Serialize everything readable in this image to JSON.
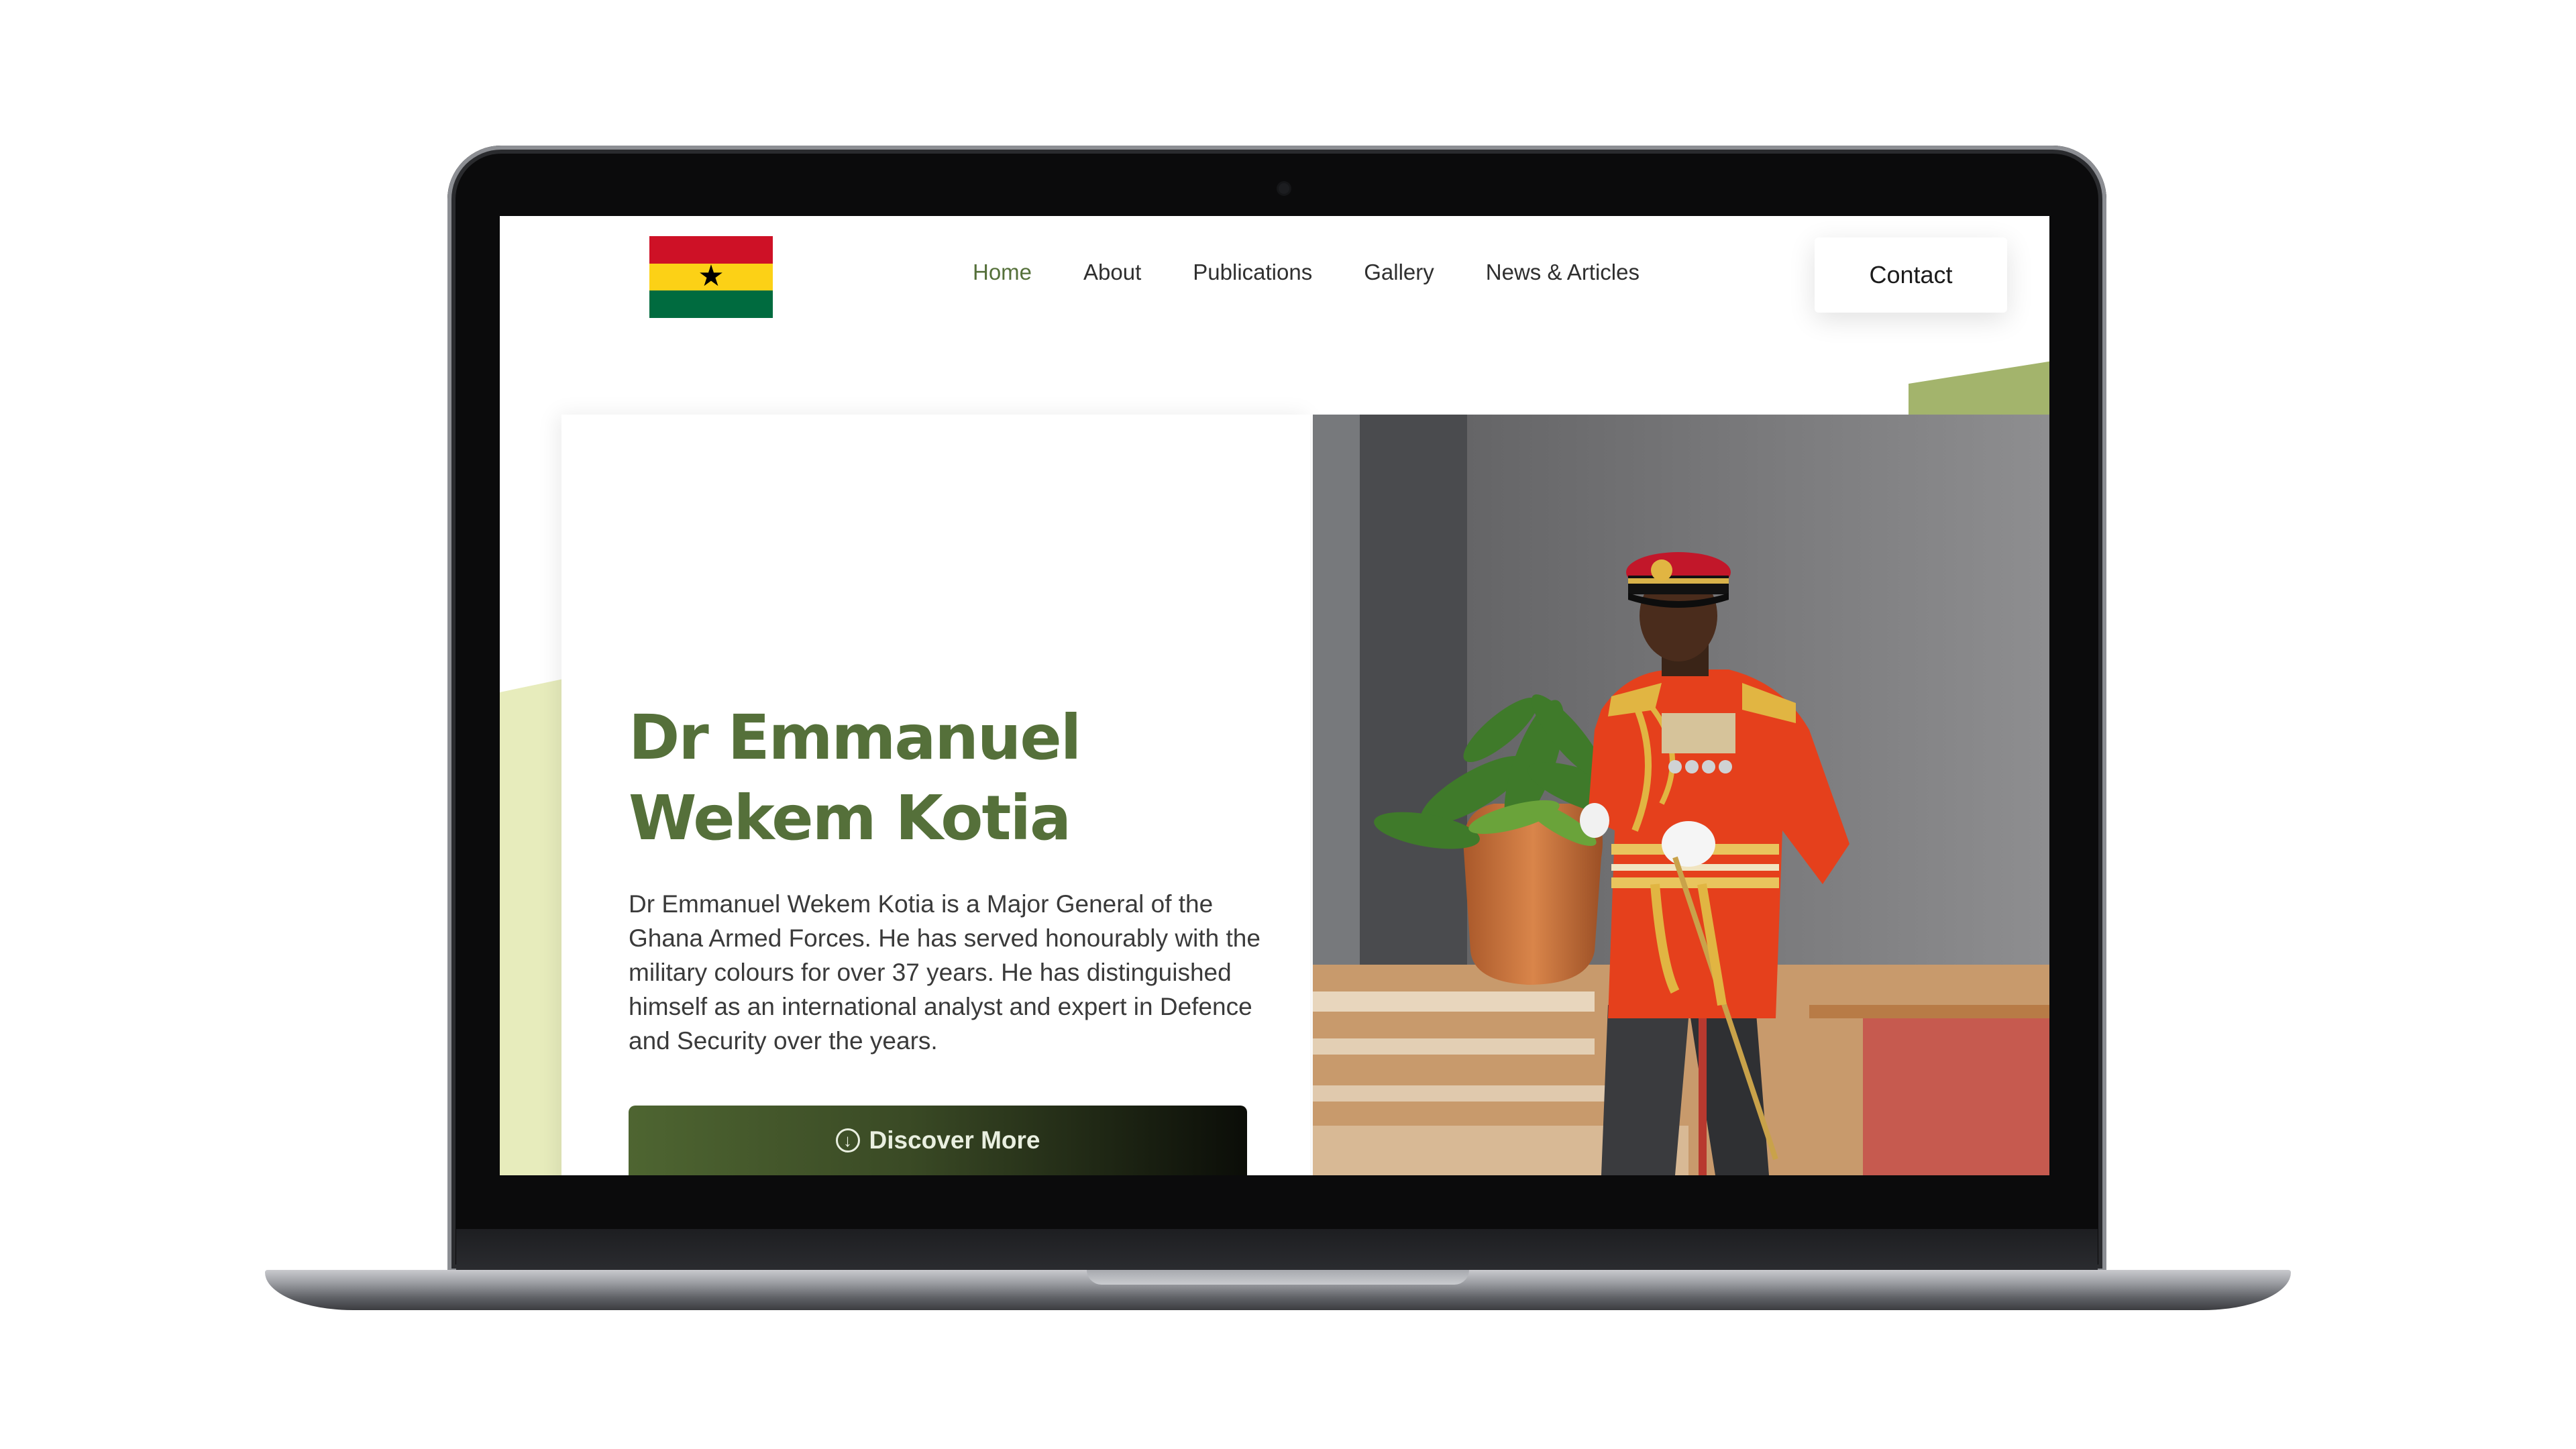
{
  "nav": {
    "logo": "ghana-flag",
    "links": [
      {
        "label": "Home",
        "active": true
      },
      {
        "label": "About",
        "active": false
      },
      {
        "label": "Publications",
        "active": false
      },
      {
        "label": "Gallery",
        "active": false
      },
      {
        "label": "News & Articles",
        "active": false
      }
    ],
    "contact_label": "Contact"
  },
  "hero": {
    "title_line1": "Dr Emmanuel",
    "title_line2": "Wekem Kotia",
    "description": "Dr Emmanuel Wekem Kotia is a Major General of the Ghana Armed Forces. He has served honourably with the military colours for over 37 years. He has distinguished himself as an international analyst and expert in Defence and Security over the years.",
    "button_label": "Discover More",
    "button_icon": "arrow-down-circle-icon",
    "photo": "officer-in-red-ceremonial-uniform"
  },
  "colors": {
    "accent_green": "#55703a",
    "light_green": "#e7ecbc",
    "flag_red": "#ce1126",
    "flag_gold": "#fcd116",
    "flag_green": "#006b3f"
  }
}
